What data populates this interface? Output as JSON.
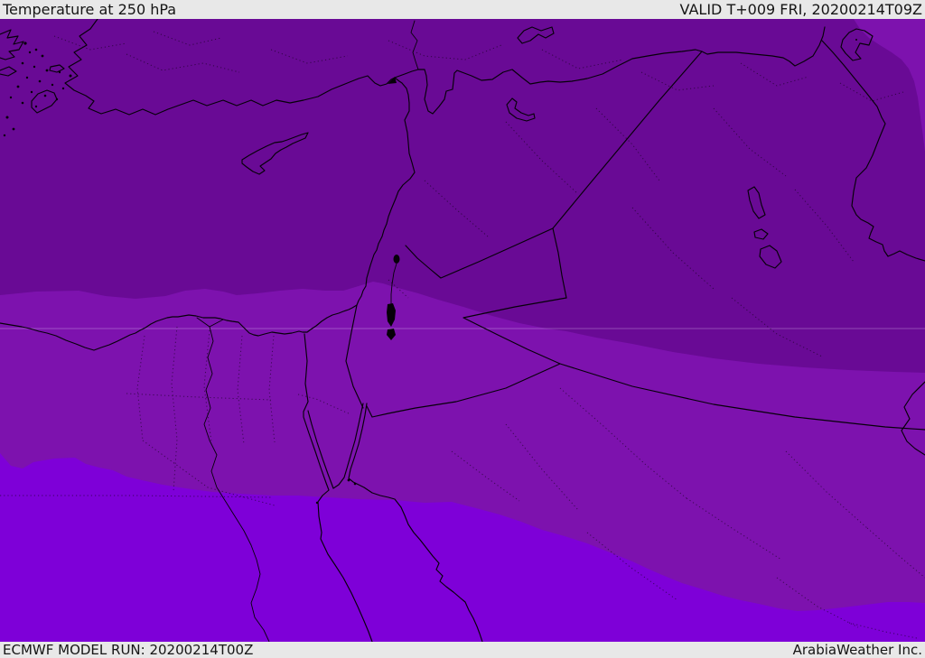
{
  "header": {
    "title": "Temperature at 250 hPa",
    "valid": "VALID T+009 FRI, 20200214T09Z"
  },
  "footer": {
    "model_run": "ECMWF MODEL RUN: 20200214T00Z",
    "brand": "ArabiaWeather Inc."
  },
  "map": {
    "palette": {
      "band_cold": "#690a95",
      "band_mid": "#7d12ae",
      "band_warm": "#7e00d8",
      "line": "#060009",
      "frame_bg": "#e8e8e8"
    }
  }
}
